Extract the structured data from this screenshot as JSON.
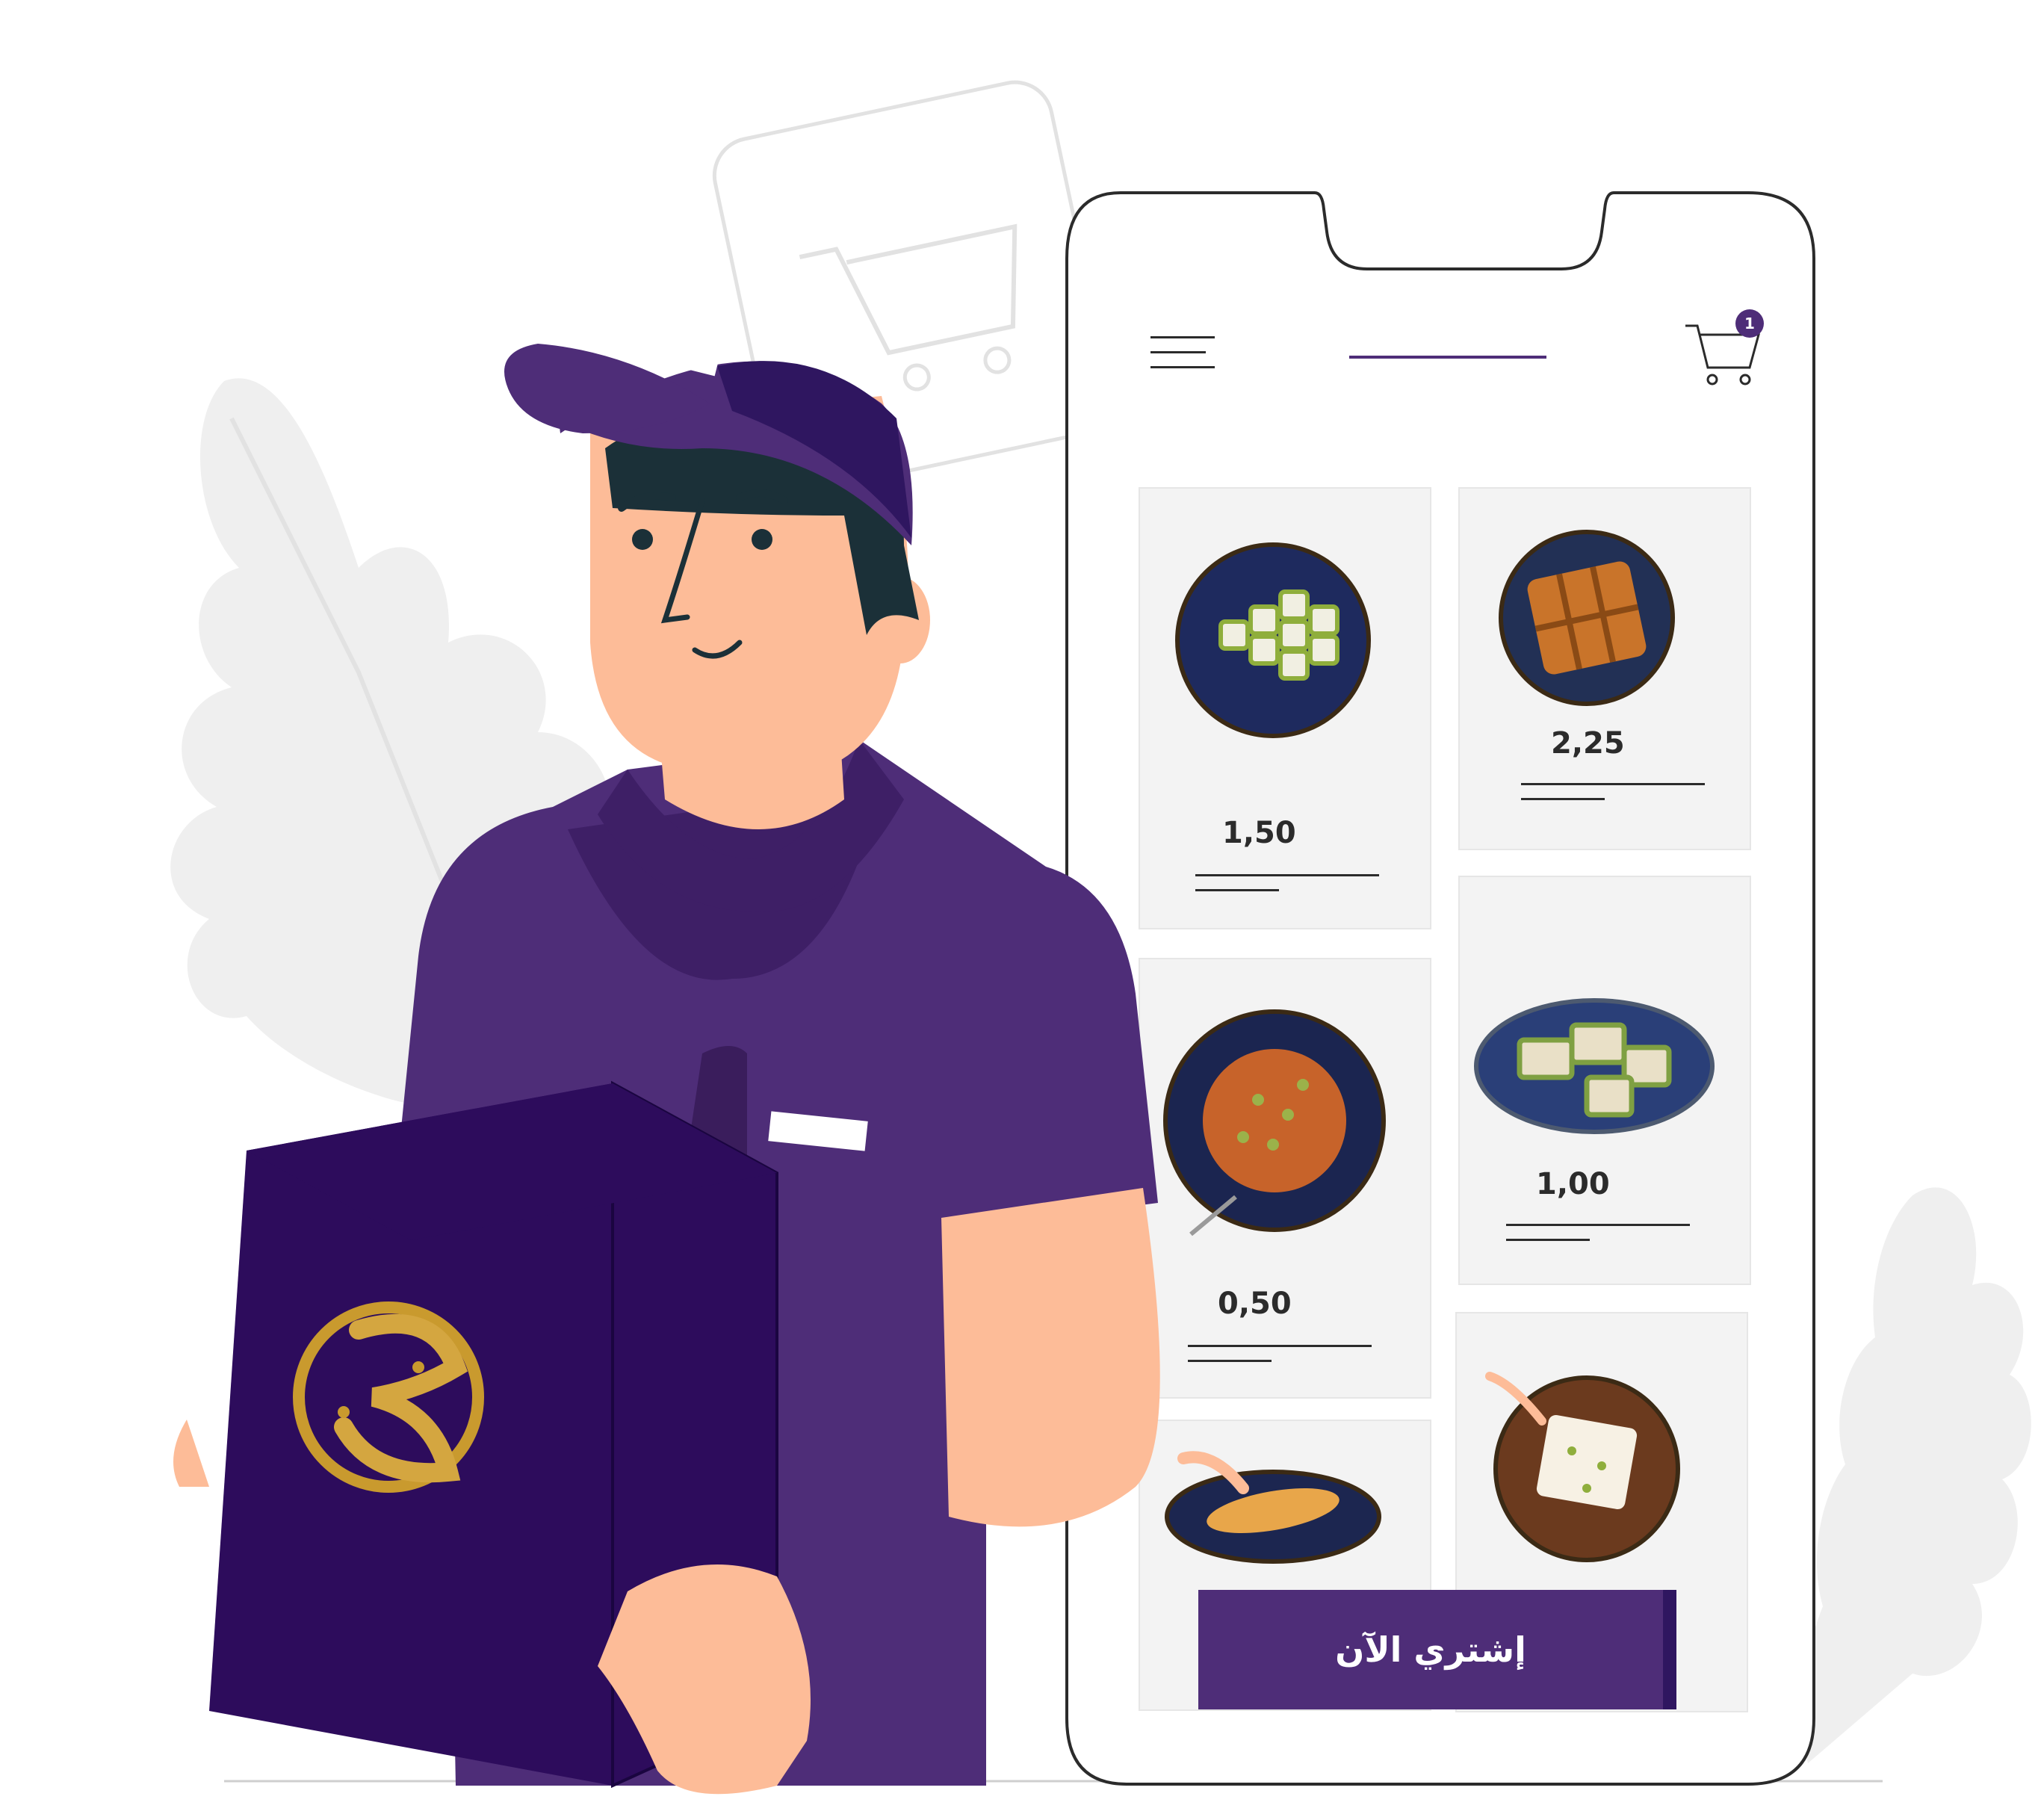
{
  "cart": {
    "count": "1"
  },
  "products": [
    {
      "price": "1,50"
    },
    {
      "price": "2,25"
    },
    {
      "price": "0,50"
    },
    {
      "price": "1,00"
    }
  ],
  "cta": {
    "label": "إشتري الآن"
  },
  "colors": {
    "brand_purple": "#4e2d78",
    "dark_purple": "#2f1660",
    "skin": "#fdbc98",
    "card_bg": "#f3f3f3",
    "gold": "#c99a2e"
  }
}
